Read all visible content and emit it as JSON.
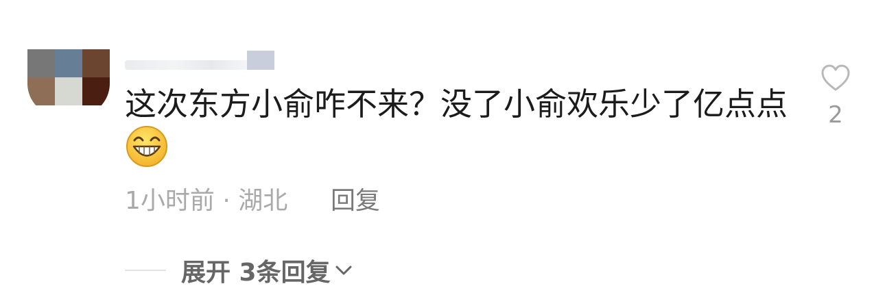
{
  "comment": {
    "avatar_colors": [
      "#777777",
      "#667f96",
      "#6b4530",
      "#8e6e56",
      "#d6d8d2",
      "#4b1e12"
    ],
    "text": "这次东方小俞咋不来？没了小俞欢乐少了亿点点",
    "emoji": "grinning-face-emoji",
    "meta": "1小时前 · 湖北",
    "reply_label": "回复",
    "like_count": "2",
    "like_icon": "heart-outline-icon",
    "expand_label": "展开 3条回复",
    "expand_icon": "chevron-down-icon"
  },
  "colors": {
    "text": "#1b1b1b",
    "meta": "#a9a9a9",
    "reply": "#7a7a7a",
    "expand": "#666666",
    "icon": "#b8b8b8"
  }
}
